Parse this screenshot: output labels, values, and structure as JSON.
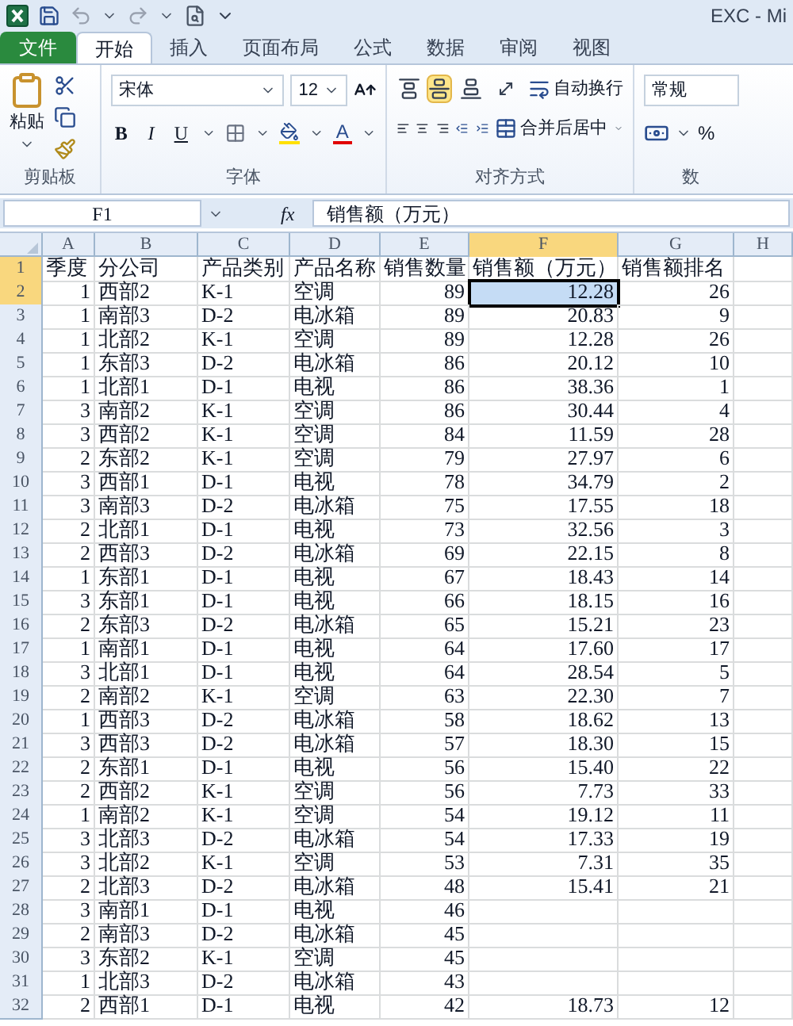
{
  "window": {
    "title": "EXC - Mi"
  },
  "tabs": [
    {
      "label": "文件",
      "kind": "file",
      "selected": false
    },
    {
      "label": "开始",
      "kind": "tab",
      "selected": true
    },
    {
      "label": "插入",
      "kind": "tab",
      "selected": false
    },
    {
      "label": "页面布局",
      "kind": "tab",
      "selected": false
    },
    {
      "label": "公式",
      "kind": "tab",
      "selected": false
    },
    {
      "label": "数据",
      "kind": "tab",
      "selected": false
    },
    {
      "label": "审阅",
      "kind": "tab",
      "selected": false
    },
    {
      "label": "视图",
      "kind": "tab",
      "selected": false
    }
  ],
  "clipboard": {
    "paste": "粘贴",
    "label": "剪贴板"
  },
  "font": {
    "name": "宋体",
    "size": "12",
    "bold": "B",
    "italic": "I",
    "underline": "U",
    "font_color": "A",
    "label": "字体"
  },
  "alignment": {
    "vertical": [
      {
        "selected": false
      },
      {
        "selected": true
      },
      {
        "selected": false
      }
    ],
    "wrap": "自动换行",
    "merge": "合并后居中",
    "label": "对齐方式"
  },
  "number": {
    "format": "常规",
    "percent": "%",
    "label": "数"
  },
  "formula_bar": {
    "name_box": "F1",
    "fx": "fx",
    "value": "销售额（万元）"
  },
  "sheet": {
    "columns": [
      {
        "label": "A",
        "selected": false
      },
      {
        "label": "B",
        "selected": false
      },
      {
        "label": "C",
        "selected": false
      },
      {
        "label": "D",
        "selected": false
      },
      {
        "label": "E",
        "selected": false
      },
      {
        "label": "F",
        "selected": true
      },
      {
        "label": "G",
        "selected": false
      },
      {
        "label": "H",
        "selected": false
      }
    ],
    "rows": [
      {
        "header": "1",
        "selected": true,
        "cells": [
          {
            "text": "季度",
            "selected": false
          },
          {
            "text": "分公司",
            "selected": false
          },
          {
            "text": "产品类别",
            "selected": false
          },
          {
            "text": "产品名称",
            "selected": false
          },
          {
            "text": "销售数量",
            "selected": false
          },
          {
            "text": "销售额（万元）",
            "selected": false
          },
          {
            "text": "销售额排名",
            "selected": false
          }
        ]
      },
      {
        "header": "2",
        "selected": true,
        "cells": [
          {
            "text": "1",
            "selected": false
          },
          {
            "text": "西部2",
            "selected": false
          },
          {
            "text": "K-1",
            "selected": false
          },
          {
            "text": "空调",
            "selected": false
          },
          {
            "text": "89",
            "selected": false
          },
          {
            "text": "12.28",
            "selected": true
          },
          {
            "text": "26",
            "selected": false
          }
        ]
      },
      {
        "header": "3",
        "selected": false,
        "cells": [
          {
            "text": "1",
            "selected": false
          },
          {
            "text": "南部3",
            "selected": false
          },
          {
            "text": "D-2",
            "selected": false
          },
          {
            "text": "电冰箱",
            "selected": false
          },
          {
            "text": "89",
            "selected": false
          },
          {
            "text": "20.83",
            "selected": false
          },
          {
            "text": "9",
            "selected": false
          }
        ]
      },
      {
        "header": "4",
        "selected": false,
        "cells": [
          {
            "text": "1",
            "selected": false
          },
          {
            "text": "北部2",
            "selected": false
          },
          {
            "text": "K-1",
            "selected": false
          },
          {
            "text": "空调",
            "selected": false
          },
          {
            "text": "89",
            "selected": false
          },
          {
            "text": "12.28",
            "selected": false
          },
          {
            "text": "26",
            "selected": false
          }
        ]
      },
      {
        "header": "5",
        "selected": false,
        "cells": [
          {
            "text": "1",
            "selected": false
          },
          {
            "text": "东部3",
            "selected": false
          },
          {
            "text": "D-2",
            "selected": false
          },
          {
            "text": "电冰箱",
            "selected": false
          },
          {
            "text": "86",
            "selected": false
          },
          {
            "text": "20.12",
            "selected": false
          },
          {
            "text": "10",
            "selected": false
          }
        ]
      },
      {
        "header": "6",
        "selected": false,
        "cells": [
          {
            "text": "1",
            "selected": false
          },
          {
            "text": "北部1",
            "selected": false
          },
          {
            "text": "D-1",
            "selected": false
          },
          {
            "text": "电视",
            "selected": false
          },
          {
            "text": "86",
            "selected": false
          },
          {
            "text": "38.36",
            "selected": false
          },
          {
            "text": "1",
            "selected": false
          }
        ]
      },
      {
        "header": "7",
        "selected": false,
        "cells": [
          {
            "text": "3",
            "selected": false
          },
          {
            "text": "南部2",
            "selected": false
          },
          {
            "text": "K-1",
            "selected": false
          },
          {
            "text": "空调",
            "selected": false
          },
          {
            "text": "86",
            "selected": false
          },
          {
            "text": "30.44",
            "selected": false
          },
          {
            "text": "4",
            "selected": false
          }
        ]
      },
      {
        "header": "8",
        "selected": false,
        "cells": [
          {
            "text": "3",
            "selected": false
          },
          {
            "text": "西部2",
            "selected": false
          },
          {
            "text": "K-1",
            "selected": false
          },
          {
            "text": "空调",
            "selected": false
          },
          {
            "text": "84",
            "selected": false
          },
          {
            "text": "11.59",
            "selected": false
          },
          {
            "text": "28",
            "selected": false
          }
        ]
      },
      {
        "header": "9",
        "selected": false,
        "cells": [
          {
            "text": "2",
            "selected": false
          },
          {
            "text": "东部2",
            "selected": false
          },
          {
            "text": "K-1",
            "selected": false
          },
          {
            "text": "空调",
            "selected": false
          },
          {
            "text": "79",
            "selected": false
          },
          {
            "text": "27.97",
            "selected": false
          },
          {
            "text": "6",
            "selected": false
          }
        ]
      },
      {
        "header": "10",
        "selected": false,
        "cells": [
          {
            "text": "3",
            "selected": false
          },
          {
            "text": "西部1",
            "selected": false
          },
          {
            "text": "D-1",
            "selected": false
          },
          {
            "text": "电视",
            "selected": false
          },
          {
            "text": "78",
            "selected": false
          },
          {
            "text": "34.79",
            "selected": false
          },
          {
            "text": "2",
            "selected": false
          }
        ]
      },
      {
        "header": "11",
        "selected": false,
        "cells": [
          {
            "text": "3",
            "selected": false
          },
          {
            "text": "南部3",
            "selected": false
          },
          {
            "text": "D-2",
            "selected": false
          },
          {
            "text": "电冰箱",
            "selected": false
          },
          {
            "text": "75",
            "selected": false
          },
          {
            "text": "17.55",
            "selected": false
          },
          {
            "text": "18",
            "selected": false
          }
        ]
      },
      {
        "header": "12",
        "selected": false,
        "cells": [
          {
            "text": "2",
            "selected": false
          },
          {
            "text": "北部1",
            "selected": false
          },
          {
            "text": "D-1",
            "selected": false
          },
          {
            "text": "电视",
            "selected": false
          },
          {
            "text": "73",
            "selected": false
          },
          {
            "text": "32.56",
            "selected": false
          },
          {
            "text": "3",
            "selected": false
          }
        ]
      },
      {
        "header": "13",
        "selected": false,
        "cells": [
          {
            "text": "2",
            "selected": false
          },
          {
            "text": "西部3",
            "selected": false
          },
          {
            "text": "D-2",
            "selected": false
          },
          {
            "text": "电冰箱",
            "selected": false
          },
          {
            "text": "69",
            "selected": false
          },
          {
            "text": "22.15",
            "selected": false
          },
          {
            "text": "8",
            "selected": false
          }
        ]
      },
      {
        "header": "14",
        "selected": false,
        "cells": [
          {
            "text": "1",
            "selected": false
          },
          {
            "text": "东部1",
            "selected": false
          },
          {
            "text": "D-1",
            "selected": false
          },
          {
            "text": "电视",
            "selected": false
          },
          {
            "text": "67",
            "selected": false
          },
          {
            "text": "18.43",
            "selected": false
          },
          {
            "text": "14",
            "selected": false
          }
        ]
      },
      {
        "header": "15",
        "selected": false,
        "cells": [
          {
            "text": "3",
            "selected": false
          },
          {
            "text": "东部1",
            "selected": false
          },
          {
            "text": "D-1",
            "selected": false
          },
          {
            "text": "电视",
            "selected": false
          },
          {
            "text": "66",
            "selected": false
          },
          {
            "text": "18.15",
            "selected": false
          },
          {
            "text": "16",
            "selected": false
          }
        ]
      },
      {
        "header": "16",
        "selected": false,
        "cells": [
          {
            "text": "2",
            "selected": false
          },
          {
            "text": "东部3",
            "selected": false
          },
          {
            "text": "D-2",
            "selected": false
          },
          {
            "text": "电冰箱",
            "selected": false
          },
          {
            "text": "65",
            "selected": false
          },
          {
            "text": "15.21",
            "selected": false
          },
          {
            "text": "23",
            "selected": false
          }
        ]
      },
      {
        "header": "17",
        "selected": false,
        "cells": [
          {
            "text": "1",
            "selected": false
          },
          {
            "text": "南部1",
            "selected": false
          },
          {
            "text": "D-1",
            "selected": false
          },
          {
            "text": "电视",
            "selected": false
          },
          {
            "text": "64",
            "selected": false
          },
          {
            "text": "17.60",
            "selected": false
          },
          {
            "text": "17",
            "selected": false
          }
        ]
      },
      {
        "header": "18",
        "selected": false,
        "cells": [
          {
            "text": "3",
            "selected": false
          },
          {
            "text": "北部1",
            "selected": false
          },
          {
            "text": "D-1",
            "selected": false
          },
          {
            "text": "电视",
            "selected": false
          },
          {
            "text": "64",
            "selected": false
          },
          {
            "text": "28.54",
            "selected": false
          },
          {
            "text": "5",
            "selected": false
          }
        ]
      },
      {
        "header": "19",
        "selected": false,
        "cells": [
          {
            "text": "2",
            "selected": false
          },
          {
            "text": "南部2",
            "selected": false
          },
          {
            "text": "K-1",
            "selected": false
          },
          {
            "text": "空调",
            "selected": false
          },
          {
            "text": "63",
            "selected": false
          },
          {
            "text": "22.30",
            "selected": false
          },
          {
            "text": "7",
            "selected": false
          }
        ]
      },
      {
        "header": "20",
        "selected": false,
        "cells": [
          {
            "text": "1",
            "selected": false
          },
          {
            "text": "西部3",
            "selected": false
          },
          {
            "text": "D-2",
            "selected": false
          },
          {
            "text": "电冰箱",
            "selected": false
          },
          {
            "text": "58",
            "selected": false
          },
          {
            "text": "18.62",
            "selected": false
          },
          {
            "text": "13",
            "selected": false
          }
        ]
      },
      {
        "header": "21",
        "selected": false,
        "cells": [
          {
            "text": "3",
            "selected": false
          },
          {
            "text": "西部3",
            "selected": false
          },
          {
            "text": "D-2",
            "selected": false
          },
          {
            "text": "电冰箱",
            "selected": false
          },
          {
            "text": "57",
            "selected": false
          },
          {
            "text": "18.30",
            "selected": false
          },
          {
            "text": "15",
            "selected": false
          }
        ]
      },
      {
        "header": "22",
        "selected": false,
        "cells": [
          {
            "text": "2",
            "selected": false
          },
          {
            "text": "东部1",
            "selected": false
          },
          {
            "text": "D-1",
            "selected": false
          },
          {
            "text": "电视",
            "selected": false
          },
          {
            "text": "56",
            "selected": false
          },
          {
            "text": "15.40",
            "selected": false
          },
          {
            "text": "22",
            "selected": false
          }
        ]
      },
      {
        "header": "23",
        "selected": false,
        "cells": [
          {
            "text": "2",
            "selected": false
          },
          {
            "text": "西部2",
            "selected": false
          },
          {
            "text": "K-1",
            "selected": false
          },
          {
            "text": "空调",
            "selected": false
          },
          {
            "text": "56",
            "selected": false
          },
          {
            "text": "7.73",
            "selected": false
          },
          {
            "text": "33",
            "selected": false
          }
        ]
      },
      {
        "header": "24",
        "selected": false,
        "cells": [
          {
            "text": "1",
            "selected": false
          },
          {
            "text": "南部2",
            "selected": false
          },
          {
            "text": "K-1",
            "selected": false
          },
          {
            "text": "空调",
            "selected": false
          },
          {
            "text": "54",
            "selected": false
          },
          {
            "text": "19.12",
            "selected": false
          },
          {
            "text": "11",
            "selected": false
          }
        ]
      },
      {
        "header": "25",
        "selected": false,
        "cells": [
          {
            "text": "3",
            "selected": false
          },
          {
            "text": "北部3",
            "selected": false
          },
          {
            "text": "D-2",
            "selected": false
          },
          {
            "text": "电冰箱",
            "selected": false
          },
          {
            "text": "54",
            "selected": false
          },
          {
            "text": "17.33",
            "selected": false
          },
          {
            "text": "19",
            "selected": false
          }
        ]
      },
      {
        "header": "26",
        "selected": false,
        "cells": [
          {
            "text": "3",
            "selected": false
          },
          {
            "text": "北部2",
            "selected": false
          },
          {
            "text": "K-1",
            "selected": false
          },
          {
            "text": "空调",
            "selected": false
          },
          {
            "text": "53",
            "selected": false
          },
          {
            "text": "7.31",
            "selected": false
          },
          {
            "text": "35",
            "selected": false
          }
        ]
      },
      {
        "header": "27",
        "selected": false,
        "cells": [
          {
            "text": "2",
            "selected": false
          },
          {
            "text": "北部3",
            "selected": false
          },
          {
            "text": "D-2",
            "selected": false
          },
          {
            "text": "电冰箱",
            "selected": false
          },
          {
            "text": "48",
            "selected": false
          },
          {
            "text": "15.41",
            "selected": false
          },
          {
            "text": "21",
            "selected": false
          }
        ]
      },
      {
        "header": "28",
        "selected": false,
        "cells": [
          {
            "text": "3",
            "selected": false
          },
          {
            "text": "南部1",
            "selected": false
          },
          {
            "text": "D-1",
            "selected": false
          },
          {
            "text": "电视",
            "selected": false
          },
          {
            "text": "46",
            "selected": false
          }
        ]
      },
      {
        "header": "29",
        "selected": false,
        "cells": [
          {
            "text": "2",
            "selected": false
          },
          {
            "text": "南部3",
            "selected": false
          },
          {
            "text": "D-2",
            "selected": false
          },
          {
            "text": "电冰箱",
            "selected": false
          },
          {
            "text": "45",
            "selected": false
          }
        ]
      },
      {
        "header": "30",
        "selected": false,
        "cells": [
          {
            "text": "3",
            "selected": false
          },
          {
            "text": "东部2",
            "selected": false
          },
          {
            "text": "K-1",
            "selected": false
          },
          {
            "text": "空调",
            "selected": false
          },
          {
            "text": "45",
            "selected": false
          }
        ]
      },
      {
        "header": "31",
        "selected": false,
        "cells": [
          {
            "text": "1",
            "selected": false
          },
          {
            "text": "北部3",
            "selected": false
          },
          {
            "text": "D-2",
            "selected": false
          },
          {
            "text": "电冰箱",
            "selected": false
          },
          {
            "text": "43",
            "selected": false
          }
        ]
      },
      {
        "header": "32",
        "selected": false,
        "cells": [
          {
            "text": "2",
            "selected": false
          },
          {
            "text": "西部1",
            "selected": false
          },
          {
            "text": "D-1",
            "selected": false
          },
          {
            "text": "电视",
            "selected": false
          },
          {
            "text": "42",
            "selected": false
          },
          {
            "text": "18.73",
            "selected": false
          },
          {
            "text": "12",
            "selected": false
          }
        ]
      }
    ]
  }
}
